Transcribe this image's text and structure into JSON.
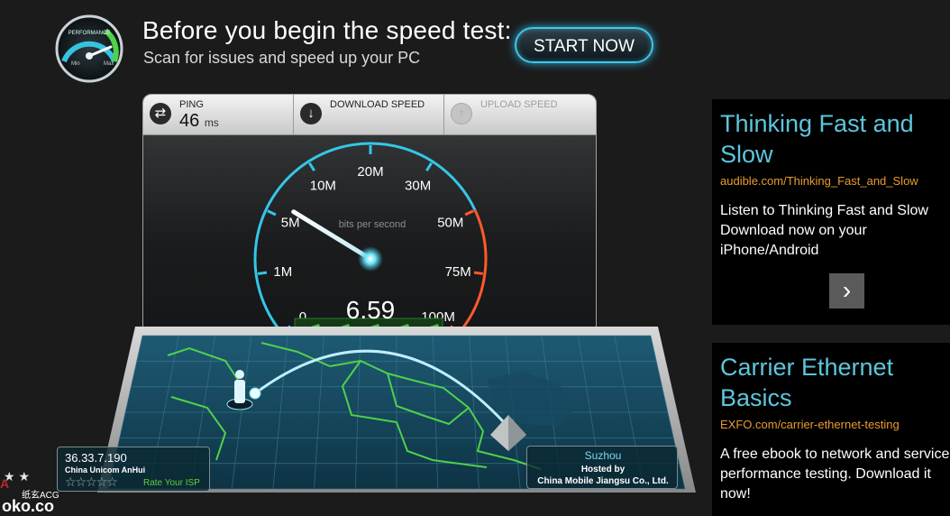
{
  "banner": {
    "title": "Before you begin the speed test:",
    "subtitle": "Scan for issues and speed up your PC",
    "start_label": "START NOW",
    "gauge_label": "PERFORMANCE",
    "gauge_min": "Min",
    "gauge_max": "Max"
  },
  "metrics": {
    "ping": {
      "label": "PING",
      "value": "46",
      "unit": "ms",
      "icon": "ping-arrows-icon"
    },
    "download": {
      "label": "DOWNLOAD SPEED",
      "icon": "download-arrow-icon"
    },
    "upload": {
      "label": "UPLOAD SPEED",
      "icon": "upload-arrow-icon"
    }
  },
  "speedometer": {
    "reading": "6.59",
    "units_label": "bits per second",
    "ticks": [
      "0",
      "1M",
      "5M",
      "10M",
      "20M",
      "30M",
      "50M",
      "75M",
      "100M"
    ],
    "needle_tick_index": 2.2,
    "accent": "#35c6e8",
    "danger": "#ff5a2c"
  },
  "isp": {
    "ip": "36.33.7.190",
    "name": "China Unicom AnHui",
    "stars": "☆☆☆☆☆",
    "rate_label": "Rate Your ISP"
  },
  "server": {
    "city": "Suzhou",
    "hosted_by": "Hosted by",
    "host": "China Mobile Jiangsu Co., Ltd."
  },
  "watermark": {
    "text": "纸玄ACG",
    "domain": "oko.co"
  },
  "ads": [
    {
      "title": "Thinking Fast and Slow",
      "url": "audible.com/Thinking_Fast_and_Slow",
      "body": "Listen to Thinking Fast and Slow Download now on your iPhone/Android",
      "arrow": "›"
    },
    {
      "title": "Carrier Ethernet Basics",
      "url": "EXFO.com/carrier-ethernet-testing",
      "body": "A free ebook to network and service performance testing. Download it now!"
    }
  ]
}
